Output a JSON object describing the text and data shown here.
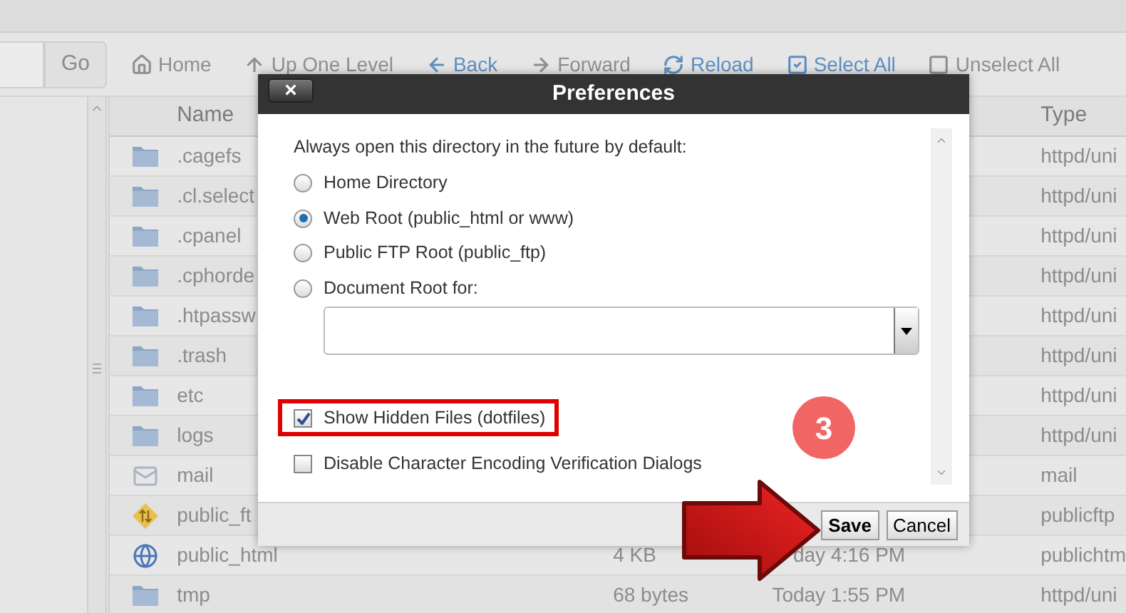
{
  "toolbar": {
    "go_button": "Go",
    "actions": [
      {
        "kind": "home",
        "label": "Home",
        "disabled": true
      },
      {
        "kind": "up",
        "label": "Up One Level",
        "disabled": true
      },
      {
        "kind": "back",
        "label": "Back",
        "disabled": false
      },
      {
        "kind": "forward",
        "label": "Forward",
        "disabled": true
      },
      {
        "kind": "reload",
        "label": "Reload",
        "disabled": false
      },
      {
        "kind": "select",
        "label": "Select All",
        "disabled": false
      },
      {
        "kind": "unselect",
        "label": "Unselect All",
        "disabled": true
      }
    ]
  },
  "table": {
    "columns": [
      "Name",
      "Type"
    ],
    "rows": [
      {
        "kind": "folder",
        "name": ".cagefs",
        "type": "httpd/uni"
      },
      {
        "kind": "folder",
        "name": ".cl.select",
        "type": "httpd/uni"
      },
      {
        "kind": "folder",
        "name": ".cpanel",
        "type": "httpd/uni"
      },
      {
        "kind": "folder",
        "name": ".cphorde",
        "type": "httpd/uni"
      },
      {
        "kind": "folder",
        "name": ".htpassw",
        "type": "httpd/uni"
      },
      {
        "kind": "folder",
        "name": ".trash",
        "type": "httpd/uni"
      },
      {
        "kind": "folder",
        "name": "etc",
        "type": "httpd/uni"
      },
      {
        "kind": "folder",
        "name": "logs",
        "type": "httpd/uni"
      },
      {
        "kind": "mail",
        "name": "mail",
        "type": "mail"
      },
      {
        "kind": "ftp",
        "name": "public_ft",
        "type": "publicftp"
      },
      {
        "kind": "web",
        "name": "public_html",
        "size": "4 KB",
        "modified": "day 4:16 PM",
        "type": "publichtm"
      },
      {
        "kind": "folder",
        "name": "tmp",
        "size": "68 bytes",
        "modified": "Today 1:55 PM",
        "type": "httpd/uni"
      }
    ]
  },
  "dialog": {
    "title": "Preferences",
    "close": "×",
    "prompt": "Always open this directory in the future by default:",
    "options": [
      {
        "label": "Home Directory",
        "selected": false
      },
      {
        "label": "Web Root (public_html or www)",
        "selected": true
      },
      {
        "label": "Public FTP Root (public_ftp)",
        "selected": false
      },
      {
        "label": "Document Root for:",
        "selected": false
      }
    ],
    "checkboxes": [
      {
        "label": "Show Hidden Files (dotfiles)",
        "checked": true,
        "highlighted": true
      },
      {
        "label": "Disable Character Encoding Verification Dialogs",
        "checked": false,
        "highlighted": false
      }
    ],
    "buttons": [
      {
        "label": "Save",
        "primary": true
      },
      {
        "label": "Cancel",
        "primary": false
      }
    ]
  },
  "annotation": {
    "step": "3",
    "arrow": true
  }
}
